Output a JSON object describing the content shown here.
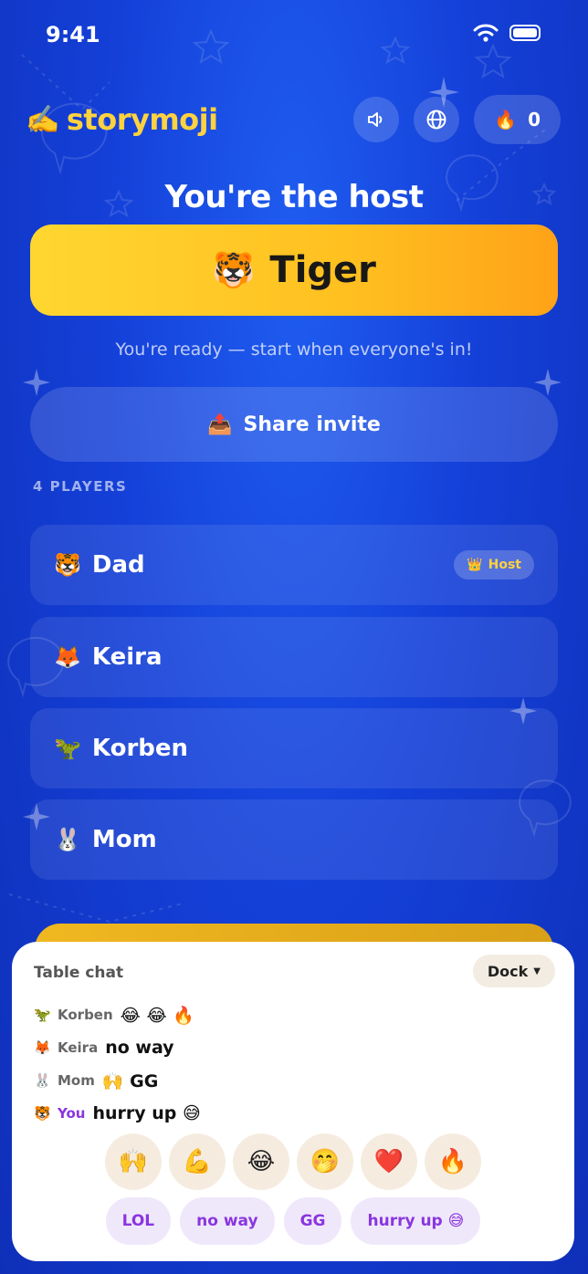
{
  "status": {
    "time": "9:41"
  },
  "app": {
    "logo_emoji": "✍️",
    "name": "storymoji"
  },
  "header": {
    "streak_emoji": "🔥",
    "streak_count": "0"
  },
  "host": {
    "title": "You're the host",
    "animal_emoji": "🐯",
    "animal_name": "Tiger",
    "ready_text": "You're ready — start when everyone's in!"
  },
  "share": {
    "emoji": "📤",
    "label": "Share invite"
  },
  "players": {
    "label": "4 PLAYERS",
    "host_badge_emoji": "👑",
    "host_badge_label": "Host",
    "items": [
      {
        "emoji": "🐯",
        "name": "Dad"
      },
      {
        "emoji": "🦊",
        "name": "Keira"
      },
      {
        "emoji": "🦖",
        "name": "Korben"
      },
      {
        "emoji": "🐰",
        "name": "Mom"
      }
    ]
  },
  "chat": {
    "title": "Table chat",
    "dock_label": "Dock",
    "messages": [
      {
        "emoji": "🦖",
        "who": "Korben",
        "text": "😂 😂 🔥"
      },
      {
        "emoji": "🦊",
        "who": "Keira",
        "text": "no way"
      },
      {
        "emoji": "🐰",
        "who": "Mom",
        "text": "🙌 GG"
      },
      {
        "emoji": "🐯",
        "who": "You",
        "text": "hurry up 😅"
      }
    ],
    "reactions": [
      "🙌",
      "💪",
      "😂",
      "🤭",
      "❤️",
      "🔥"
    ],
    "phrases": [
      "LOL",
      "no way",
      "GG",
      "hurry up 😅"
    ]
  },
  "colors": {
    "accent": "#ffd23f",
    "background": "#1440d8",
    "you": "#8a35e0"
  }
}
